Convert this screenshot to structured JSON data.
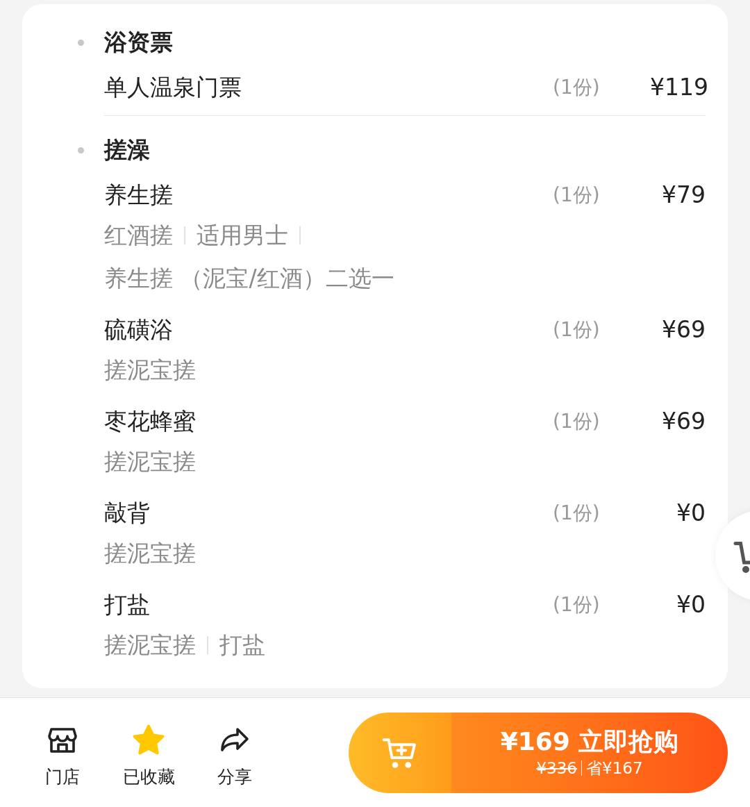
{
  "sections": [
    {
      "title": "浴资票",
      "items": [
        {
          "name": "单人温泉门票",
          "qty": "(1份)",
          "price": "¥119"
        }
      ]
    },
    {
      "title": "搓澡",
      "items": [
        {
          "name": "养生搓",
          "qty": "(1份)",
          "price": "¥79",
          "tag_rows": [
            [
              "红酒搓",
              "适用男士"
            ],
            [
              "养生搓 （泥宝/红酒）二选一"
            ]
          ]
        },
        {
          "name": "硫磺浴",
          "qty": "(1份)",
          "price": "¥69",
          "tag_rows": [
            [
              "搓泥宝搓"
            ]
          ]
        },
        {
          "name": "枣花蜂蜜",
          "qty": "(1份)",
          "price": "¥69",
          "tag_rows": [
            [
              "搓泥宝搓"
            ]
          ]
        },
        {
          "name": "敲背",
          "qty": "(1份)",
          "price": "¥0",
          "tag_rows": [
            [
              "搓泥宝搓"
            ]
          ]
        },
        {
          "name": "打盐",
          "qty": "(1份)",
          "price": "¥0",
          "tag_rows": [
            [
              "搓泥宝搓",
              "打盐"
            ]
          ]
        }
      ]
    }
  ],
  "bottom_bar": {
    "actions": [
      {
        "kind": "store",
        "label": "门店"
      },
      {
        "kind": "favorite",
        "label": "已收藏",
        "selected": true
      },
      {
        "kind": "share",
        "label": "分享"
      }
    ],
    "buy_button": {
      "price": "¥169",
      "label": "立即抢购",
      "original_price": "¥336",
      "savings": "省¥167"
    }
  }
}
